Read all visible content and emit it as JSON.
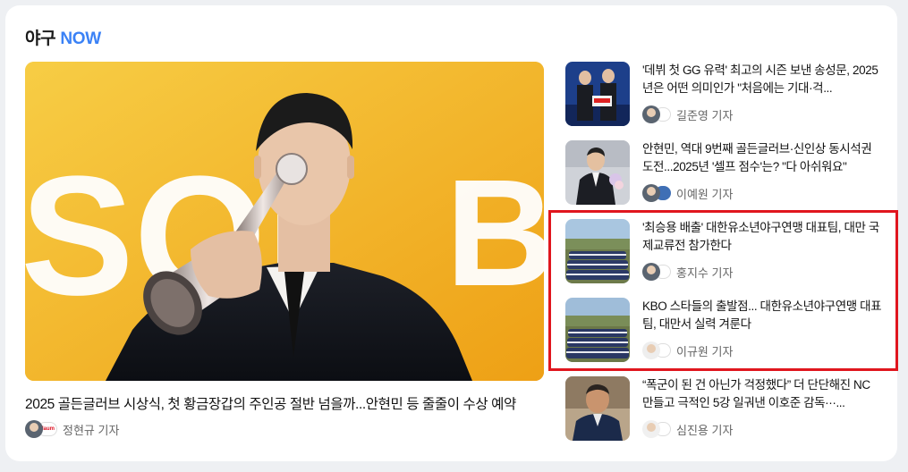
{
  "section": {
    "title_main": "야구",
    "title_accent": "NOW"
  },
  "main_story": {
    "headline": "2025 골든글러브 시상식, 첫 황금장갑의 주인공 절반 넘을까...안현민 등 줄줄이 수상 예약",
    "reporter": "정현규 기자",
    "press": "daum"
  },
  "side_stories": [
    {
      "title": "'데뷔 첫 GG 유력' 최고의 시즌 보낸 송성문, 2025년은 어떤 의미인가 \"처음에는 기대·걱...",
      "reporter": "길준영 기자"
    },
    {
      "title": "안현민, 역대 9번째 골든글러브·신인상 동시석권 도전...2025년 '셀프 점수'는? \"다 아쉬워요\"",
      "reporter": "이예원 기자"
    },
    {
      "title": "'최승용 배출' 대한유소년야구연맹 대표팀, 대만 국제교류전 참가한다",
      "reporter": "홍지수 기자"
    },
    {
      "title": "KBO 스타들의 출발점... 대한유소년야구연맹 대표팀, 대만서 실력 겨룬다",
      "reporter": "이규원 기자"
    },
    {
      "title": "“폭군이 된 건 아닌가 걱정했다” 더 단단해진 NC 만들고 극적인 5강 일궈낸 이호준 감독···...",
      "reporter": "심진용 기자"
    }
  ],
  "colors": {
    "accent": "#3b82f6",
    "highlight_border": "#e0161e"
  }
}
